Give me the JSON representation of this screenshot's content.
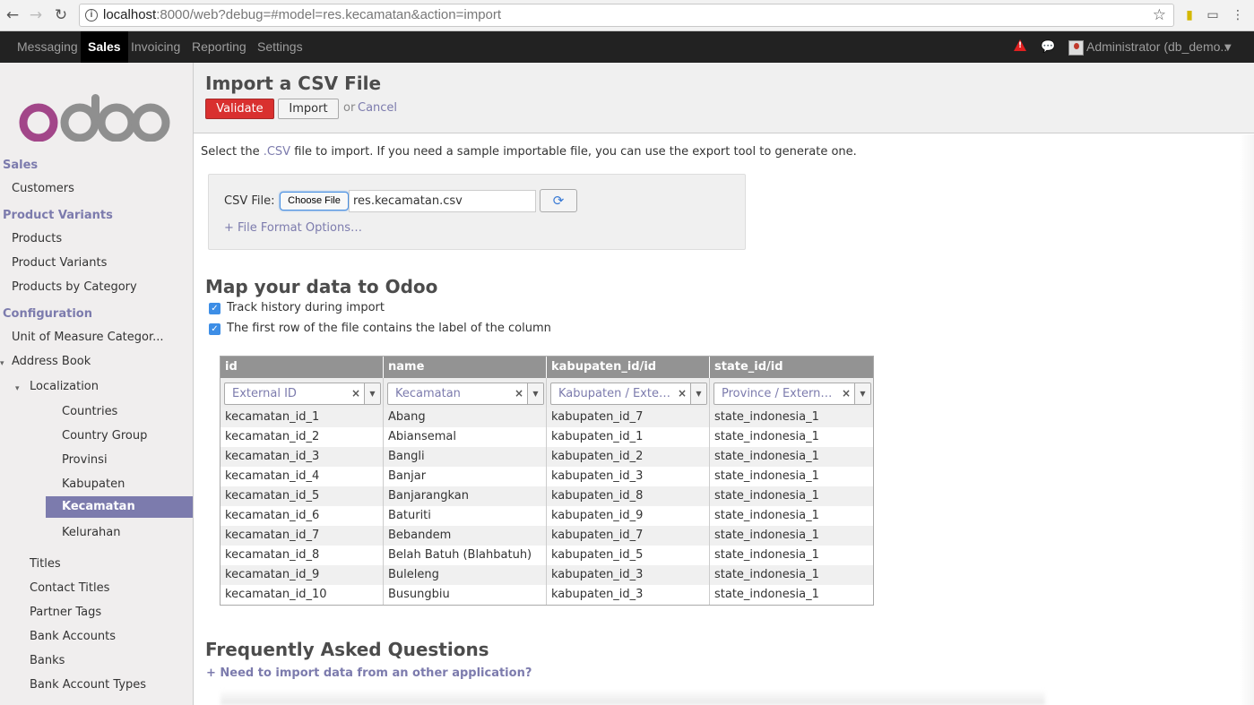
{
  "browser": {
    "url_host": "localhost",
    "url_rest": ":8000/web?debug=#model=res.kecamatan&action=import"
  },
  "topbar": {
    "menus": [
      "Messaging",
      "Sales",
      "Invoicing",
      "Reporting",
      "Settings"
    ],
    "active_menu": "Sales",
    "user": "Administrator (db_demo.."
  },
  "sidebar": {
    "logo": "odoo",
    "items": [
      {
        "label": "Sales",
        "type": "header"
      },
      {
        "label": "Customers",
        "type": "item"
      },
      {
        "label": "Product Variants",
        "type": "header"
      },
      {
        "label": "Products",
        "type": "item"
      },
      {
        "label": "Product Variants",
        "type": "item"
      },
      {
        "label": "Products by Category",
        "type": "item"
      },
      {
        "label": "Configuration",
        "type": "header"
      },
      {
        "label": "Unit of Measure Categor...",
        "type": "item"
      },
      {
        "label": "Address Book",
        "type": "item"
      },
      {
        "label": "Localization",
        "type": "item"
      },
      {
        "label": "Countries",
        "type": "item"
      },
      {
        "label": "Country Group",
        "type": "item"
      },
      {
        "label": "Provinsi",
        "type": "item"
      },
      {
        "label": "Kabupaten",
        "type": "item"
      },
      {
        "label": "Kecamatan",
        "type": "selected"
      },
      {
        "label": "Kelurahan",
        "type": "item"
      },
      {
        "label": "Titles",
        "type": "item"
      },
      {
        "label": "Contact Titles",
        "type": "item"
      },
      {
        "label": "Partner Tags",
        "type": "item"
      },
      {
        "label": "Bank Accounts",
        "type": "item"
      },
      {
        "label": "Banks",
        "type": "item"
      },
      {
        "label": "Bank Account Types",
        "type": "item"
      }
    ]
  },
  "control_panel": {
    "title": "Import a CSV File",
    "validate": "Validate",
    "import": "Import",
    "or": "or",
    "cancel": "Cancel"
  },
  "intro": {
    "before": "Select the ",
    "csv": ".CSV",
    "after": " file to import. If you need a sample importable file, you can use the export tool to generate one."
  },
  "file": {
    "label": "CSV File:",
    "choose": "Choose File",
    "name": "res.kecamatan.csv",
    "format_options": "+ File Format Options…"
  },
  "mapping": {
    "title": "Map your data to Odoo",
    "track_history": "Track history during import",
    "first_row_label": "The first row of the file contains the label of the column",
    "columns": [
      "id",
      "name",
      "kabupaten_id/id",
      "state_id/id"
    ],
    "field_selects": [
      "External ID",
      "Kecamatan",
      "Kabupaten / Exte…",
      "Province / Extern…"
    ],
    "rows": [
      [
        "kecamatan_id_1",
        "Abang",
        "kabupaten_id_7",
        "state_indonesia_1"
      ],
      [
        "kecamatan_id_2",
        "Abiansemal",
        "kabupaten_id_1",
        "state_indonesia_1"
      ],
      [
        "kecamatan_id_3",
        "Bangli",
        "kabupaten_id_2",
        "state_indonesia_1"
      ],
      [
        "kecamatan_id_4",
        "Banjar",
        "kabupaten_id_3",
        "state_indonesia_1"
      ],
      [
        "kecamatan_id_5",
        "Banjarangkan",
        "kabupaten_id_8",
        "state_indonesia_1"
      ],
      [
        "kecamatan_id_6",
        "Baturiti",
        "kabupaten_id_9",
        "state_indonesia_1"
      ],
      [
        "kecamatan_id_7",
        "Bebandem",
        "kabupaten_id_7",
        "state_indonesia_1"
      ],
      [
        "kecamatan_id_8",
        "Belah Batuh (Blahbatuh)",
        "kabupaten_id_5",
        "state_indonesia_1"
      ],
      [
        "kecamatan_id_9",
        "Buleleng",
        "kabupaten_id_3",
        "state_indonesia_1"
      ],
      [
        "kecamatan_id_10",
        "Busungbiu",
        "kabupaten_id_3",
        "state_indonesia_1"
      ]
    ]
  },
  "faq": {
    "title": "Frequently Asked Questions",
    "q1": "+ Need to import data from an other application?"
  }
}
